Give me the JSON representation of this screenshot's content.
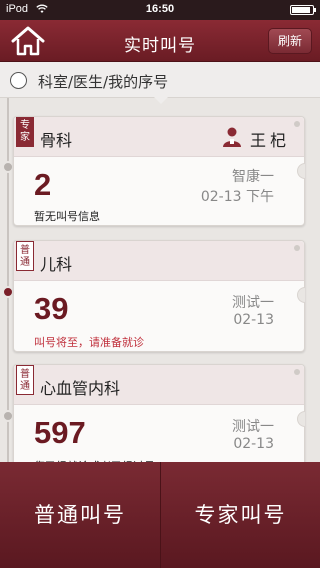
{
  "status_bar": {
    "carrier": "iPod",
    "time": "16:50"
  },
  "nav": {
    "title": "实时叫号",
    "refresh_label": "刷新"
  },
  "filter": {
    "label": "科室/医生/我的序号"
  },
  "cards": [
    {
      "badge": "专家",
      "department": "骨科",
      "doctor": "王杞",
      "number": "2",
      "patient": "智康一",
      "date": "02-13 下午",
      "status": "暂无叫号信息"
    },
    {
      "badge": "普通",
      "department": "儿科",
      "number": "39",
      "patient": "测试一",
      "date": "02-13",
      "status": "叫号将至，请准备就诊"
    },
    {
      "badge": "普通",
      "department": "心血管内科",
      "number": "597",
      "patient": "测试一",
      "date": "02-13",
      "status": "您已经就诊或者已经过号"
    }
  ],
  "tabs": {
    "normal": "普通叫号",
    "expert": "专家叫号"
  },
  "colors": {
    "brand": "#7a2a33",
    "number": "#6b1a22",
    "alert": "#c0303c"
  }
}
